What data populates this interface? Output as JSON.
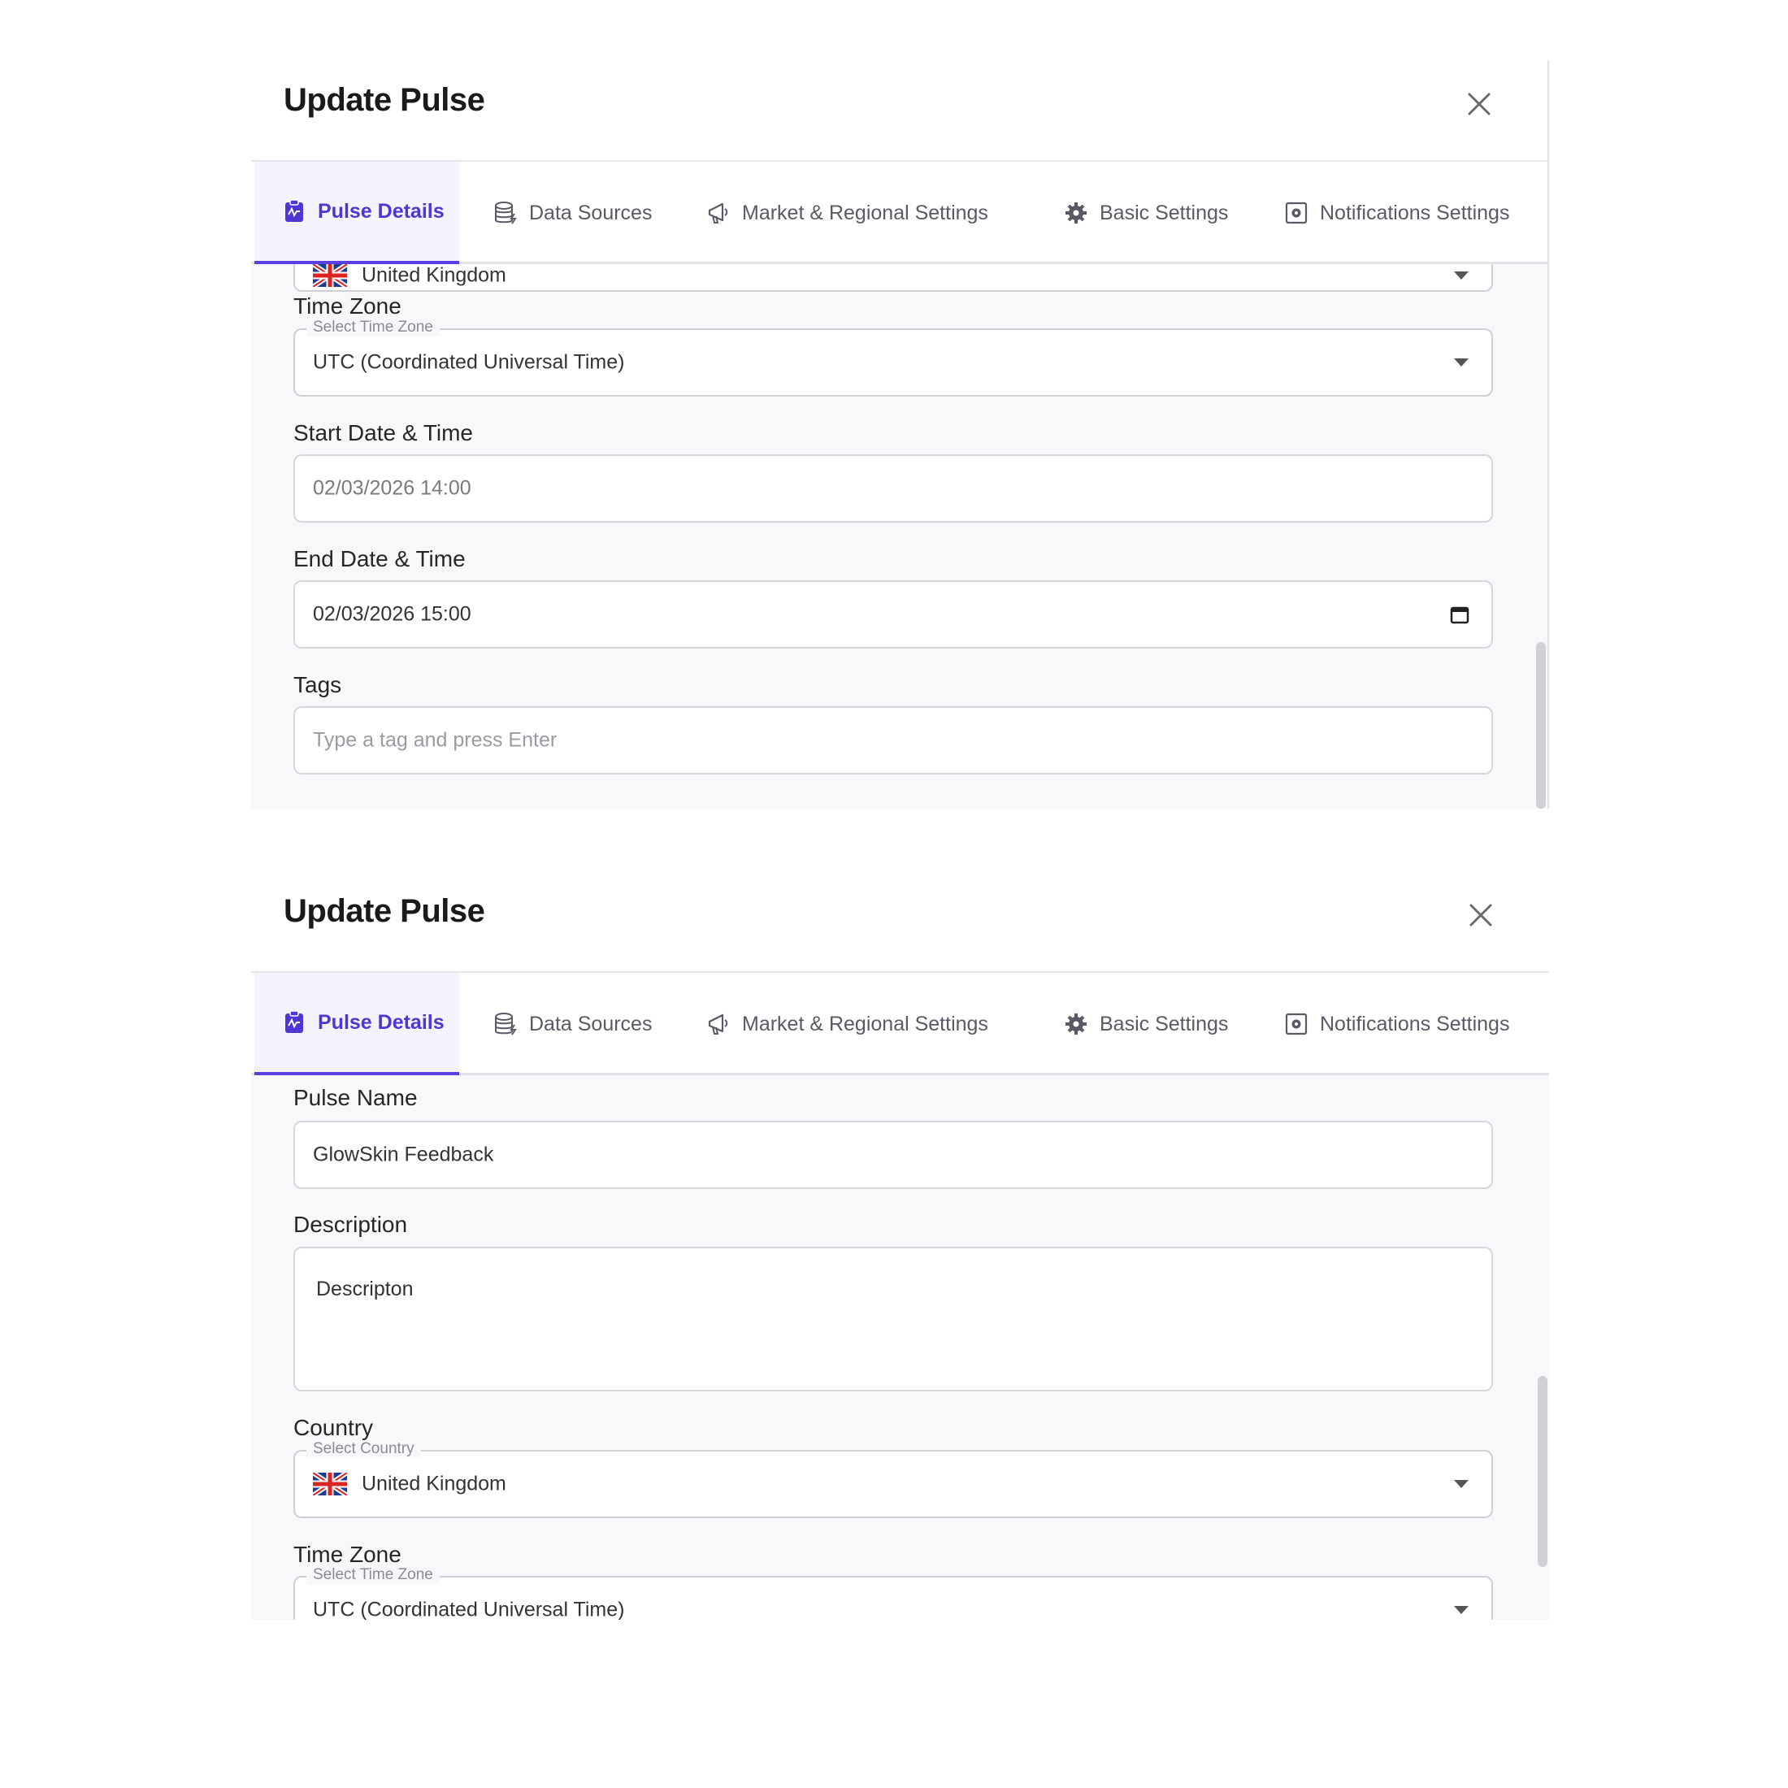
{
  "dialog": {
    "title": "Update Pulse"
  },
  "tabs": [
    {
      "label": "Pulse Details",
      "icon": "clipboard-pulse-icon",
      "active": true
    },
    {
      "label": "Data Sources",
      "icon": "database-icon",
      "active": false
    },
    {
      "label": "Market & Regional Settings",
      "icon": "megaphone-icon",
      "active": false
    },
    {
      "label": "Basic Settings",
      "icon": "gear-icon",
      "active": false
    },
    {
      "label": "Notifications Settings",
      "icon": "notification-settings-icon",
      "active": false
    }
  ],
  "form": {
    "pulse_name_label": "Pulse Name",
    "pulse_name_value": "GlowSkin Feedback",
    "description_label": "Description",
    "description_value": "Descripton",
    "country_label": "Country",
    "country_legend": "Select Country",
    "country_value": "United Kingdom",
    "timezone_label": "Time Zone",
    "timezone_legend": "Select Time Zone",
    "timezone_value": "UTC (Coordinated Universal Time)",
    "start_label": "Start Date & Time",
    "start_value": "02/03/2026 14:00",
    "end_label": "End Date & Time",
    "end_value": "02/03/2026 15:00",
    "tags_label": "Tags",
    "tags_placeholder": "Type a tag and press Enter"
  },
  "colors": {
    "accent": "#5b3fe0",
    "active_tab_text": "#4f35d3"
  }
}
